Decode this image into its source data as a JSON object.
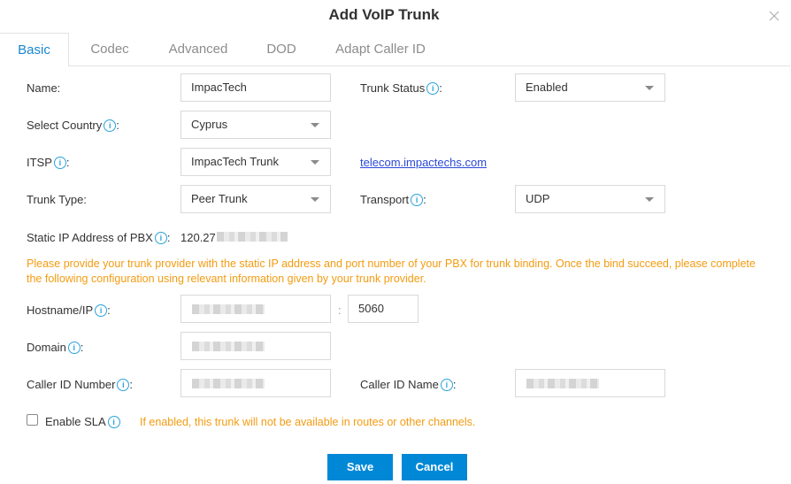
{
  "dialog": {
    "title": "Add VoIP Trunk",
    "close_icon": "close-icon"
  },
  "tabs": [
    {
      "label": "Basic",
      "active": true
    },
    {
      "label": "Codec",
      "active": false
    },
    {
      "label": "Advanced",
      "active": false
    },
    {
      "label": "DOD",
      "active": false
    },
    {
      "label": "Adapt Caller ID",
      "active": false
    }
  ],
  "form": {
    "name": {
      "label": "Name:",
      "value": "ImpacTech"
    },
    "trunk_status": {
      "label": "Trunk Status",
      "value": "Enabled"
    },
    "country": {
      "label": "Select Country",
      "value": "Cyprus"
    },
    "itsp": {
      "label": "ITSP",
      "value": "ImpacTech Trunk",
      "link": "telecom.impactechs.com"
    },
    "trunk_type": {
      "label": "Trunk Type:",
      "value": "Peer Trunk"
    },
    "transport": {
      "label": "Transport",
      "value": "UDP"
    },
    "static_ip": {
      "label": "Static IP Address of PBX",
      "value": "120.27"
    },
    "notice": "Please provide your trunk provider with the static IP address and port number of your PBX for trunk binding. Once the bind succeed, please complete the following configuration using relevant information given by your trunk provider.",
    "hostname": {
      "label": "Hostname/IP",
      "value": "",
      "port_separator": ":",
      "port": "5060"
    },
    "domain": {
      "label": "Domain",
      "value": ""
    },
    "caller_id_number": {
      "label": "Caller ID Number",
      "value": ""
    },
    "caller_id_name": {
      "label": "Caller ID Name",
      "value": ""
    },
    "enable_sla": {
      "label": "Enable SLA",
      "checked": false,
      "hint": "If enabled, this trunk will not be available in routes or other channels."
    },
    "colon": ":",
    "info_glyph": "i"
  },
  "buttons": {
    "save": "Save",
    "cancel": "Cancel"
  },
  "colors": {
    "accent": "#0088d7",
    "tab_active": "#1a87cf",
    "info_icon": "#2aa2dd",
    "warning": "#f39c12"
  }
}
